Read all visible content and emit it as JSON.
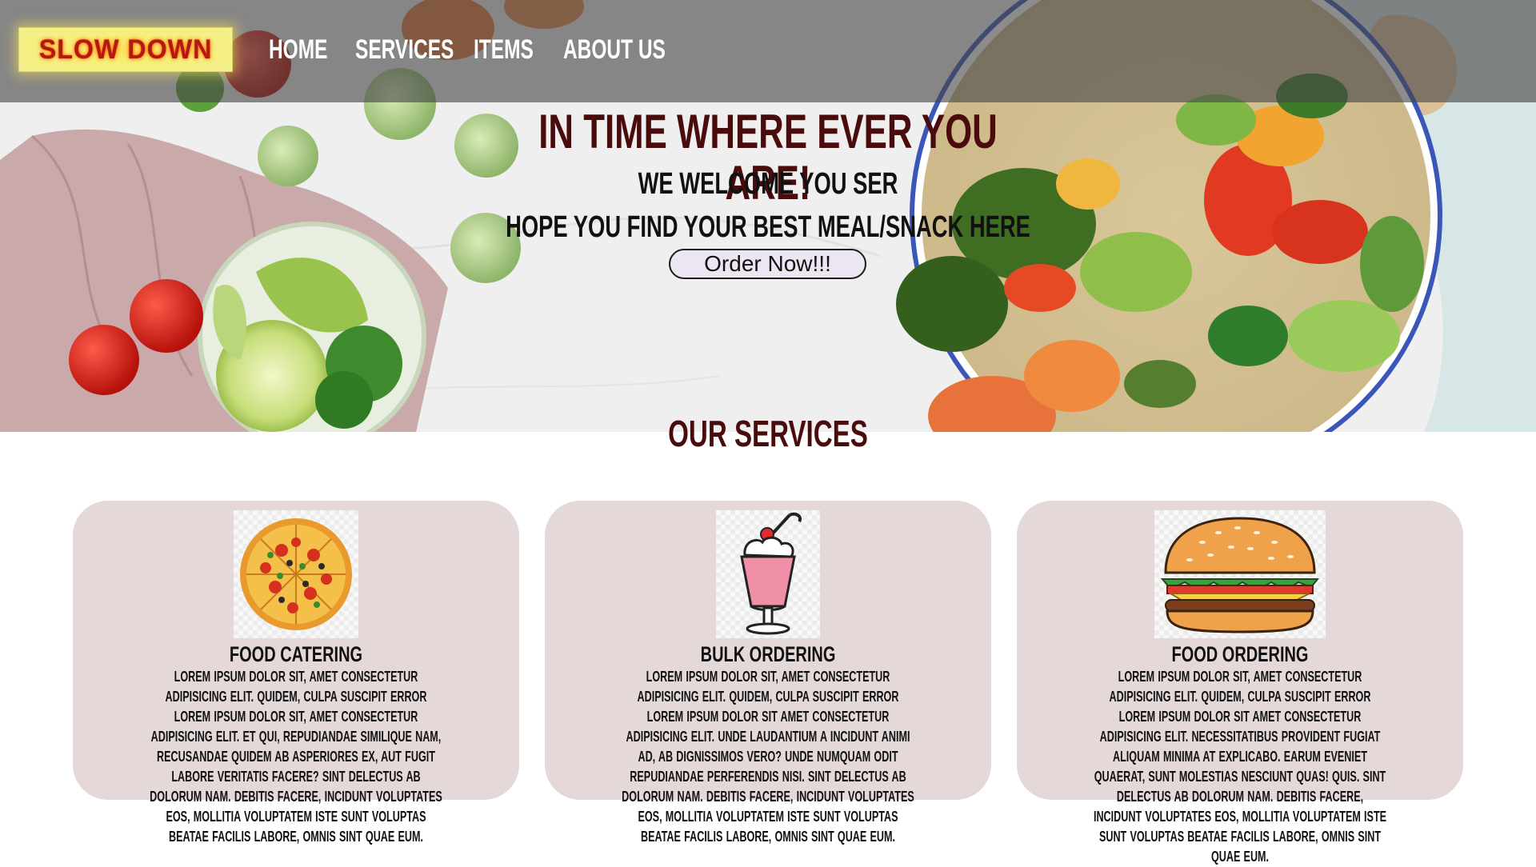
{
  "brand": {
    "logo_text": "SLOW DOWN"
  },
  "nav": {
    "items": [
      {
        "label": "HOME"
      },
      {
        "label": "SERVICES"
      },
      {
        "label": "ITEMS"
      },
      {
        "label": "ABOUT US"
      }
    ]
  },
  "hero": {
    "title": "IN TIME WHERE EVER YOU ARE!",
    "welcome": "WE WELCOME YOU SER",
    "tagline": "HOPE YOU FIND YOUR BEST MEAL/SNACK HERE",
    "cta_label": "Order Now!!!"
  },
  "services": {
    "heading": "OUR SERVICES",
    "cards": [
      {
        "icon": "pizza-icon",
        "title": "FOOD CATERING",
        "text": "LOREM IPSUM DOLOR SIT, AMET CONSECTETUR ADIPISICING ELIT. QUIDEM, CULPA SUSCIPIT ERROR LOREM IPSUM DOLOR SIT, AMET CONSECTETUR ADIPISICING ELIT. ET QUI, REPUDIANDAE SIMILIQUE NAM, RECUSANDAE QUIDEM AB ASPERIORES EX, AUT FUGIT LABORE VERITATIS FACERE? SINT DELECTUS AB DOLORUM NAM. DEBITIS FACERE, INCIDUNT VOLUPTATES EOS, MOLLITIA VOLUPTATEM ISTE SUNT VOLUPTAS BEATAE FACILIS LABORE, OMNIS SINT QUAE EUM."
      },
      {
        "icon": "milkshake-icon",
        "title": "BULK ORDERING",
        "text": "LOREM IPSUM DOLOR SIT, AMET CONSECTETUR ADIPISICING ELIT. QUIDEM, CULPA SUSCIPIT ERROR LOREM IPSUM DOLOR SIT AMET CONSECTETUR ADIPISICING ELIT. UNDE LAUDANTIUM A INCIDUNT ANIMI AD, AB DIGNISSIMOS VERO? UNDE NUMQUAM ODIT REPUDIANDAE PERFERENDIS NISI. SINT DELECTUS AB DOLORUM NAM. DEBITIS FACERE, INCIDUNT VOLUPTATES EOS, MOLLITIA VOLUPTATEM ISTE SUNT VOLUPTAS BEATAE FACILIS LABORE, OMNIS SINT QUAE EUM."
      },
      {
        "icon": "burger-icon",
        "title": "FOOD ORDERING",
        "text": "LOREM IPSUM DOLOR SIT, AMET CONSECTETUR ADIPISICING ELIT. QUIDEM, CULPA SUSCIPIT ERROR LOREM IPSUM DOLOR SIT AMET CONSECTETUR ADIPISICING ELIT. NECESSITATIBUS PROVIDENT FUGIAT ALIQUAM MINIMA AT EXPLICABO. EARUM EVENIET QUAERAT, SUNT MOLESTIAS NESCIUNT QUAS! QUIS. SINT DELECTUS AB DOLORUM NAM. DEBITIS FACERE, INCIDUNT VOLUPTATES EOS, MOLLITIA VOLUPTATEM ISTE SUNT VOLUPTAS BEATAE FACILIS LABORE, OMNIS SINT QUAE EUM."
      }
    ]
  },
  "colors": {
    "heading": "#4a0b0d",
    "card_bg": "#e5d8d8",
    "nav_overlay": "#464646",
    "button_bg": "#ece6f3"
  }
}
